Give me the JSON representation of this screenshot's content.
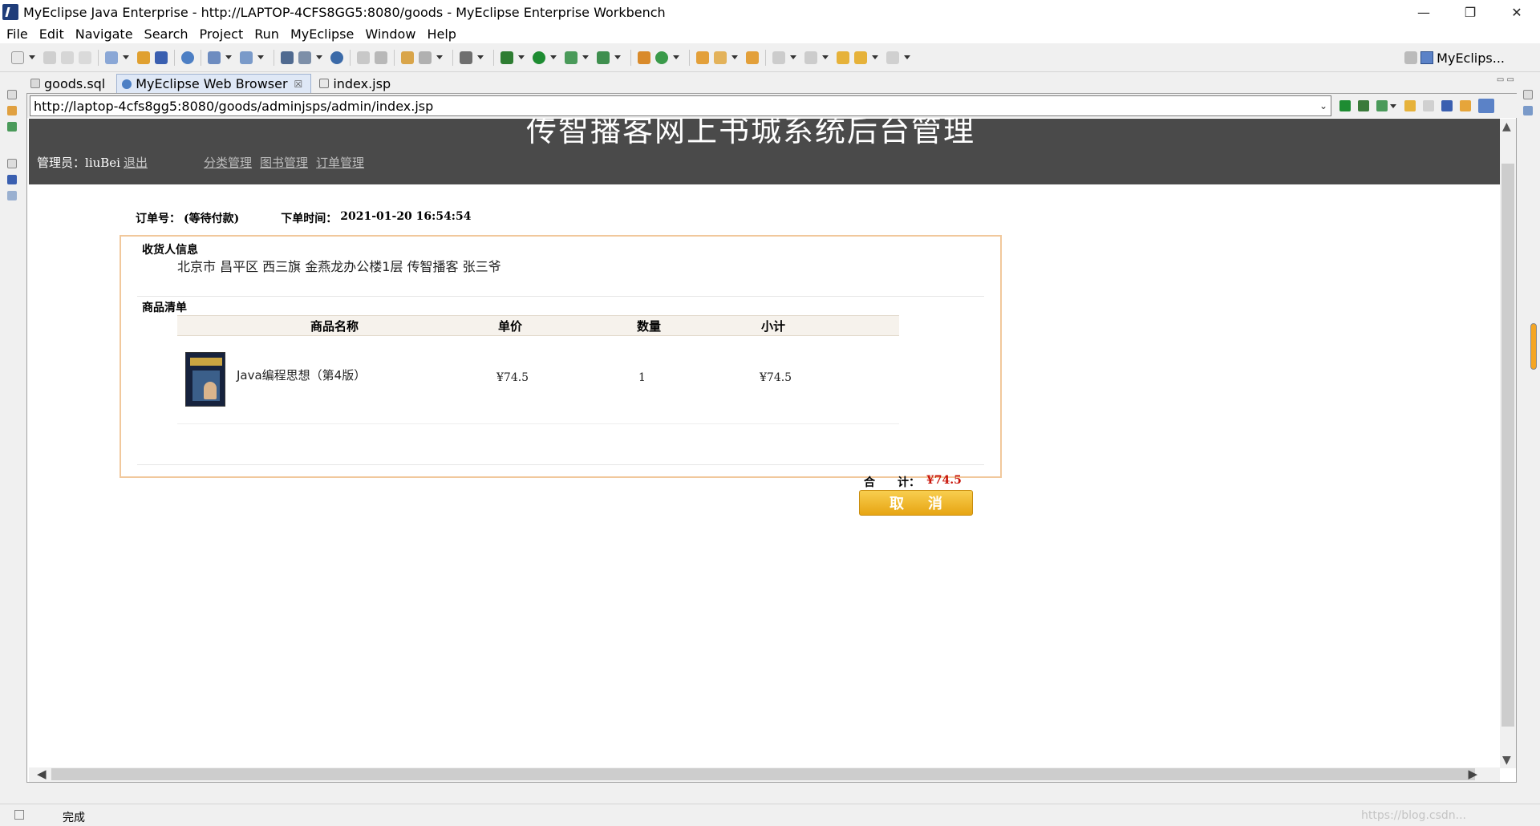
{
  "window": {
    "title": "MyEclipse Java Enterprise - http://LAPTOP-4CFS8GG5:8080/goods - MyEclipse Enterprise Workbench",
    "minimize": "—",
    "restore": "❐",
    "close": "✕"
  },
  "menu": [
    "File",
    "Edit",
    "Navigate",
    "Search",
    "Project",
    "Run",
    "MyEclipse",
    "Window",
    "Help"
  ],
  "toolbar": {
    "perspective_label": "MyEclips..."
  },
  "tabs": [
    {
      "label": "goods.sql",
      "icon": "sql-file-icon"
    },
    {
      "label": "MyEclipse Web Browser",
      "icon": "globe-icon",
      "close": "☒"
    },
    {
      "label": "index.jsp",
      "icon": "jsp-file-icon"
    }
  ],
  "browser": {
    "url": "http://laptop-4cfs8gg5:8080/goods/adminjsps/admin/index.jsp",
    "url_dropdown": "⌄"
  },
  "page": {
    "title": "传智播客网上书城系统后台管理",
    "admin_label": "管理员：",
    "admin_name": "liuBei",
    "logout": "退出",
    "nav": [
      "分类管理",
      "图书管理",
      "订单管理"
    ]
  },
  "order": {
    "number_label": "订单号：",
    "status": "(等待付款)",
    "time_label": "下单时间：",
    "time": "2021-01-20 16:54:54",
    "receiver_label": "收货人信息",
    "address": "北京市  昌平区  西三旗  金燕龙办公楼1层  传智播客  张三爷",
    "items_label": "商品清单",
    "columns": [
      "商品名称",
      "单价",
      "数量",
      "小计"
    ],
    "items": [
      {
        "name": "Java编程思想（第4版）",
        "price": "¥74.5",
        "quantity": "1",
        "subtotal": "¥74.5"
      }
    ],
    "total_label": "合　　计：",
    "total": "¥74.5",
    "cancel_label": "取消"
  },
  "status": {
    "text": "完成",
    "watermark": "https://blog.csdn..."
  },
  "colors": {
    "header_bg": "#4a4a4a",
    "card_border": "#f1c89c",
    "total_red": "#c8150a",
    "button_gold": "#e7a513"
  }
}
